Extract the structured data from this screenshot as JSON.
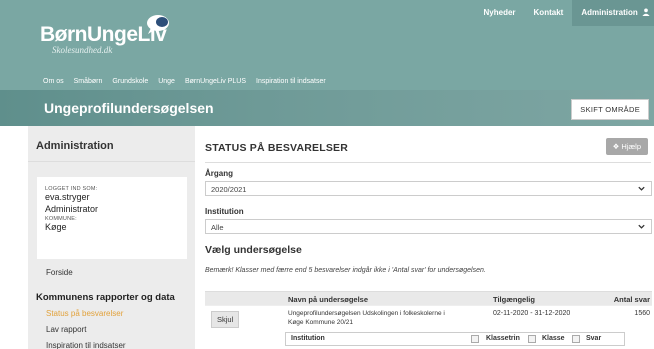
{
  "topnav": {
    "nyheder": "Nyheder",
    "kontakt": "Kontakt",
    "administration": "Administration"
  },
  "logo": {
    "title": "BørnUngeLiv",
    "subtitle": "Skolesundhed.dk"
  },
  "mainnav": [
    "Om os",
    "Småbørn",
    "Grundskole",
    "Unge",
    "BørnUngeLiv PLUS",
    "Inspiration til indsatser"
  ],
  "titlebar": {
    "title": "Ungeprofilundersøgelsen",
    "switch_button": "SKIFT OMRÅDE"
  },
  "sidebar": {
    "heading": "Administration",
    "logged_in_label": "LOGGET IND SOM:",
    "username": "eva.stryger",
    "role": "Administrator",
    "municipality_label": "KOMMUNE:",
    "municipality": "Køge",
    "forside": "Forside",
    "section": "Kommunens rapporter og data",
    "items": [
      "Status på besvarelser",
      "Lav rapport",
      "Inspiration til indsatser"
    ]
  },
  "main": {
    "heading": "STATUS PÅ BESVARELSER",
    "help_button": "Hjælp",
    "argang_label": "Årgang",
    "argang_value": "2020/2021",
    "institution_label": "Institution",
    "institution_value": "Alle",
    "section_title": "Vælg undersøgelse",
    "note": "Bemærk! Klasser med færre end 5 besvarelser indgår ikke i 'Antal svar' for undersøgelsen.",
    "table": {
      "headers": [
        "Navn på undersøgelse",
        "Tilgængelig",
        "Antal svar"
      ],
      "row": {
        "button": "Skjul",
        "name_line1": "Ungeprofilundersøgelsen Udskolingen i folkeskolerne i",
        "name_line2": "Køge Kommune 20/21",
        "available": "02-11-2020 - 31-12-2020",
        "answers": "1560"
      },
      "sub_headers": [
        "Institution",
        "Klassetrin",
        "Klasse",
        "Svar"
      ]
    }
  },
  "colors": {
    "header": "#7aa7a3",
    "accent": "#e2a23b",
    "sidebar_bg": "#ececec"
  }
}
